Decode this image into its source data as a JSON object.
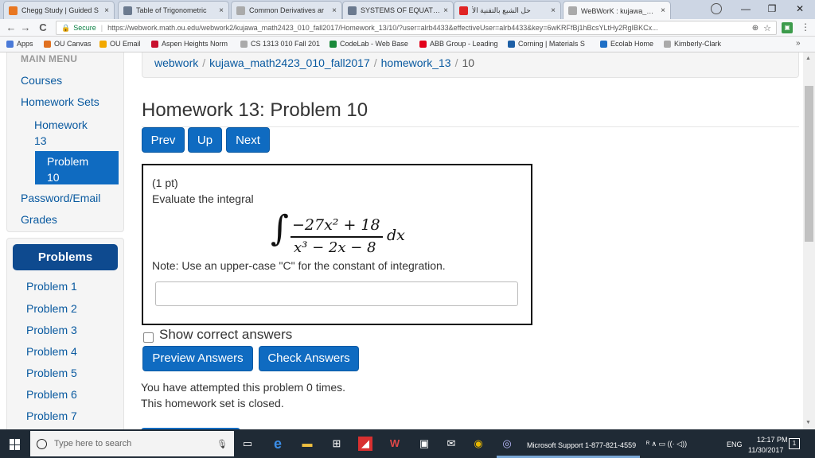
{
  "browser": {
    "tabs": [
      {
        "title": "Chegg Study | Guided S",
        "favicon_color": "#e87722"
      },
      {
        "title": "Table of Trigonometric",
        "favicon_color": "#6b7a8f"
      },
      {
        "title": "Common Derivatives ar",
        "favicon_color": "#aaaaaa"
      },
      {
        "title": "SYSTEMS OF EQUATION",
        "favicon_color": "#6b7a8f"
      },
      {
        "title": "حل الشبع بالتقنية الأ",
        "favicon_color": "#e02424"
      },
      {
        "title": "WeBWorK : kujawa_mat",
        "favicon_color": "#aaaaaa"
      }
    ],
    "tab_close_glyph": "×",
    "window_controls": {
      "minimize": "—",
      "maximize": "❐",
      "close": "✕"
    },
    "nav": {
      "back": "←",
      "forward": "→",
      "reload": "C"
    },
    "secure_label": "Secure",
    "url": "https://webwork.math.ou.edu/webwork2/kujawa_math2423_010_fall2017/Homework_13/10/?user=alrb4433&effectiveUser=alrb4433&key=6wKRFfBj1hBcsYLtHy2RgIBKCx...",
    "bookmarks": [
      {
        "label": "Apps",
        "color": "#4a7ad8"
      },
      {
        "label": "OU Canvas",
        "color": "#e07020"
      },
      {
        "label": "OU Email",
        "color": "#f2a900"
      },
      {
        "label": "Aspen Heights Norm",
        "color": "#c8102e"
      },
      {
        "label": "CS 1313 010 Fall 201",
        "color": "#aaaaaa"
      },
      {
        "label": "CodeLab - Web Base",
        "color": "#1a8a3a"
      },
      {
        "label": "ABB Group - Leading",
        "color": "#e2001a"
      },
      {
        "label": "Corning | Materials S",
        "color": "#1d5fa6"
      },
      {
        "label": "Ecolab Home",
        "color": "#1e6fc6"
      },
      {
        "label": "Kimberly-Clark",
        "color": "#aaaaaa"
      }
    ],
    "bookmarks_more": "»"
  },
  "sidebar": {
    "main_menu_title": "MAIN MENU",
    "links": {
      "courses": "Courses",
      "homework_sets": "Homework Sets",
      "homework_13_line1": "Homework",
      "homework_13_line2": "13",
      "problem_10_line1": "Problem",
      "problem_10_line2": "10",
      "password_email": "Password/Email",
      "grades": "Grades"
    },
    "problems_heading": "Problems",
    "problems": [
      "Problem 1",
      "Problem 2",
      "Problem 3",
      "Problem 4",
      "Problem 5",
      "Problem 6",
      "Problem 7"
    ]
  },
  "breadcrumb": {
    "items": [
      "webwork",
      "kujawa_math2423_010_fall2017",
      "homework_13"
    ],
    "current": "10",
    "separator": "/"
  },
  "main": {
    "title": "Homework 13: Problem 10",
    "nav_buttons": {
      "prev": "Prev",
      "up": "Up",
      "next": "Next"
    },
    "problem": {
      "points": "(1 pt)",
      "instruction": "Evaluate the integral",
      "integral_sign": "∫",
      "numerator": "−27x² + 18",
      "denominator": "x³ − 2x − 8",
      "differential": "dx",
      "note": "Note: Use an upper-case \"C\" for the constant of integration.",
      "answer_value": ""
    },
    "show_correct_answers_label": "Show correct answers",
    "show_correct_answers_checked": false,
    "actions": {
      "preview": "Preview Answers",
      "check": "Check Answers"
    },
    "attempts_message": "You have attempted this problem 0 times.",
    "closed_message": "This homework set is closed."
  },
  "taskbar": {
    "search_placeholder": "Type here to search",
    "active_window_label": "Microsoft Support 1-877-821-4559",
    "tray_icons": "ᴿ  ∧  ▭  ((·  ◁))",
    "language": "ENG",
    "time": "12:17 PM",
    "date": "11/30/2017",
    "notification_count": "1"
  }
}
